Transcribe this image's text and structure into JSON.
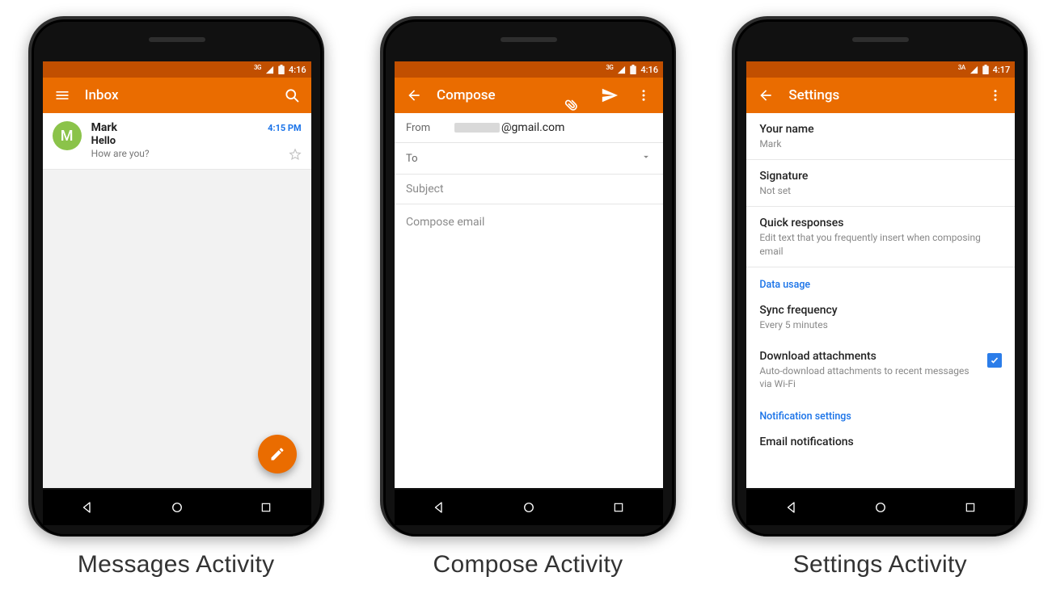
{
  "labels": {
    "messages": "Messages Activity",
    "compose": "Compose Activity",
    "settings": "Settings Activity"
  },
  "colors": {
    "primary": "#ea6c00",
    "primary_dark": "#c14f00",
    "link_blue": "#1a73e8"
  },
  "inbox": {
    "status": {
      "net": "3G",
      "time": "4:16"
    },
    "appbar": {
      "title": "Inbox"
    },
    "messages": [
      {
        "avatar_letter": "M",
        "from": "Mark",
        "time": "4:15 PM",
        "subject": "Hello",
        "snippet": "How are you?"
      }
    ]
  },
  "compose": {
    "status": {
      "net": "3G",
      "time": "4:16"
    },
    "appbar": {
      "title": "Compose"
    },
    "from_label": "From",
    "from_value": "@gmail.com",
    "to_label": "To",
    "subject_placeholder": "Subject",
    "body_placeholder": "Compose email"
  },
  "settings": {
    "status": {
      "net": "3A",
      "time": "4:17"
    },
    "appbar": {
      "title": "Settings"
    },
    "items": [
      {
        "title": "Your name",
        "sub": "Mark"
      },
      {
        "title": "Signature",
        "sub": "Not set"
      },
      {
        "title": "Quick responses",
        "sub": "Edit text that you frequently insert when composing email"
      }
    ],
    "section_data_usage": "Data usage",
    "sync": {
      "title": "Sync frequency",
      "sub": "Every 5 minutes"
    },
    "download": {
      "title": "Download attachments",
      "sub": "Auto-download attachments to recent messages via Wi-Fi",
      "checked": true
    },
    "section_notif": "Notification settings",
    "email_notif": {
      "title": "Email notifications"
    }
  }
}
